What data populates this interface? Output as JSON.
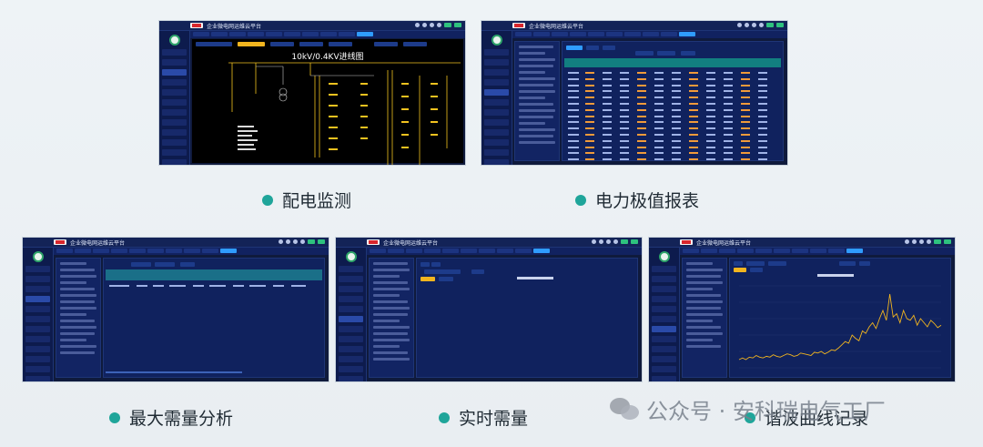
{
  "app": {
    "brand_text": "Acrel",
    "title": "企业微电网运维云平台"
  },
  "panels": [
    {
      "id": "distribution-monitoring",
      "caption": "配电监测",
      "diagram_title": "10kV/0.4KV进线图"
    },
    {
      "id": "power-extreme-report",
      "caption": "电力极值报表"
    },
    {
      "id": "max-demand-analysis",
      "caption": "最大需量分析"
    },
    {
      "id": "realtime-demand",
      "caption": "实时需量"
    },
    {
      "id": "harmonic-curve-record",
      "caption": "谐波曲线记录"
    }
  ],
  "watermark": {
    "text": "公众号 · 安科瑞电气工厂"
  },
  "colors": {
    "panel_bg": "#0f1a3c",
    "accent_teal": "#1fa59a",
    "yellow_line": "#f2b51f",
    "orange_value": "#f09a3a",
    "table_head": "#127f80"
  },
  "chart_data": {
    "type": "line",
    "title": "",
    "xlabel": "",
    "ylabel": "",
    "series": [
      {
        "values": [
          0.1,
          0.12,
          0.1,
          0.13,
          0.12,
          0.15,
          0.13,
          0.12,
          0.14,
          0.13,
          0.16,
          0.14,
          0.13,
          0.15,
          0.17,
          0.16,
          0.14,
          0.15,
          0.18,
          0.17,
          0.16,
          0.15,
          0.19,
          0.18,
          0.2,
          0.17,
          0.19,
          0.22,
          0.21,
          0.24,
          0.28,
          0.32,
          0.3,
          0.4,
          0.36,
          0.33,
          0.45,
          0.42,
          0.5,
          0.55,
          0.48,
          0.6,
          0.7,
          0.58,
          0.9,
          0.62,
          0.66,
          0.55,
          0.7,
          0.6,
          0.58,
          0.64,
          0.52,
          0.6,
          0.55,
          0.5,
          0.58,
          0.54,
          0.49,
          0.52
        ]
      }
    ]
  }
}
